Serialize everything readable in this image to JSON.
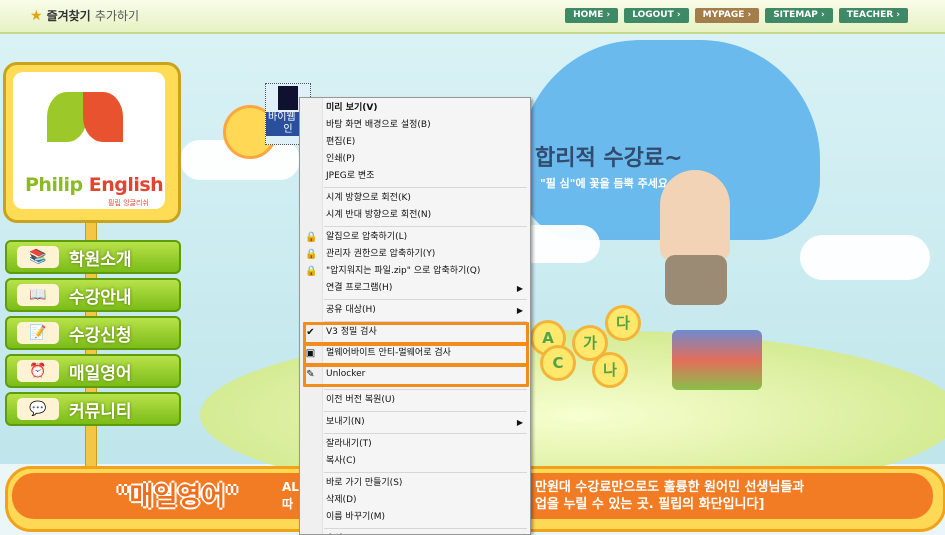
{
  "topbar": {
    "favorite": "즐겨찾기",
    "favorite_add": "추가하기",
    "nav": [
      {
        "label": "HOME ›",
        "color": "#3e8a66"
      },
      {
        "label": "LOGOUT ›",
        "color": "#3e8a66"
      },
      {
        "label": "MYPAGE ›",
        "color": "#a37d4a"
      },
      {
        "label": "SITEMAP ›",
        "color": "#3e8a66"
      },
      {
        "label": "TEACHER ›",
        "color": "#3e8a66"
      }
    ]
  },
  "logo": {
    "brand_a": "Philip",
    "brand_b": "English",
    "sub": "필립 잉글리쉬"
  },
  "sidebar": {
    "items": [
      {
        "label": "학원소개",
        "icon": "📚"
      },
      {
        "label": "수강안내",
        "icon": "📖"
      },
      {
        "label": "수강신청",
        "icon": "📝"
      },
      {
        "label": "매일영어",
        "icon": "⏰"
      },
      {
        "label": "커뮤니티",
        "icon": "💬"
      }
    ]
  },
  "hero": {
    "slogan_a": "합리적 수강료~",
    "slogan_b": "\"필 심\"에 꽃을 듬뿍 주세요.",
    "flowers": [
      "A",
      "다",
      "가",
      "C",
      "나"
    ]
  },
  "desktop_file": {
    "label": "바이웹 피인"
  },
  "context_menu": {
    "items": [
      {
        "label": "미리 보기(V)",
        "bold": true
      },
      {
        "label": "바탕 화면 배경으로 설정(B)"
      },
      {
        "label": "편집(E)"
      },
      {
        "label": "인쇄(P)"
      },
      {
        "label": "JPEG로 변조"
      },
      {
        "sep": true
      },
      {
        "label": "시계 방향으로 회전(K)"
      },
      {
        "label": "시계 반대 방향으로 회전(N)"
      },
      {
        "sep": true
      },
      {
        "label": "알집으로 압축하기(L)",
        "icon": "🔒"
      },
      {
        "label": "관리자 권한으로 압축하기(Y)",
        "icon": "🔒"
      },
      {
        "label": "\"압지워지는 파일.zip\" 으로 압축하기(Q)",
        "icon": "🔒"
      },
      {
        "label": "연결 프로그램(H)",
        "arrow": true
      },
      {
        "sep": true
      },
      {
        "label": "공유 대상(H)",
        "arrow": true
      },
      {
        "sep": true
      },
      {
        "label": "V3 정밀 검사",
        "icon": "✔",
        "highlight": true
      },
      {
        "label": "멀웨어바이트 안티-멀웨어로 검사",
        "icon": "▣",
        "highlight": true
      },
      {
        "label": "Unlocker",
        "icon": "✎",
        "highlight": true
      },
      {
        "sep": true
      },
      {
        "label": "이전 버전 복원(U)"
      },
      {
        "sep": true
      },
      {
        "label": "보내기(N)",
        "arrow": true
      },
      {
        "sep": true
      },
      {
        "label": "잘라내기(T)"
      },
      {
        "label": "복사(C)"
      },
      {
        "sep": true
      },
      {
        "label": "바로 가기 만들기(S)"
      },
      {
        "label": "삭제(D)"
      },
      {
        "label": "이름 바꾸기(M)"
      },
      {
        "sep": true
      },
      {
        "label": "속성(R)"
      }
    ]
  },
  "banner": {
    "title": "\"매일영어\"",
    "text_a": "AL",
    "text_b": "따",
    "text_c": "만원대 수강료만으로도 훌륭한 원어민 선생님들과",
    "text_d": "업을 누릴 수 있는 곳. 필립의 화단입니다]"
  }
}
